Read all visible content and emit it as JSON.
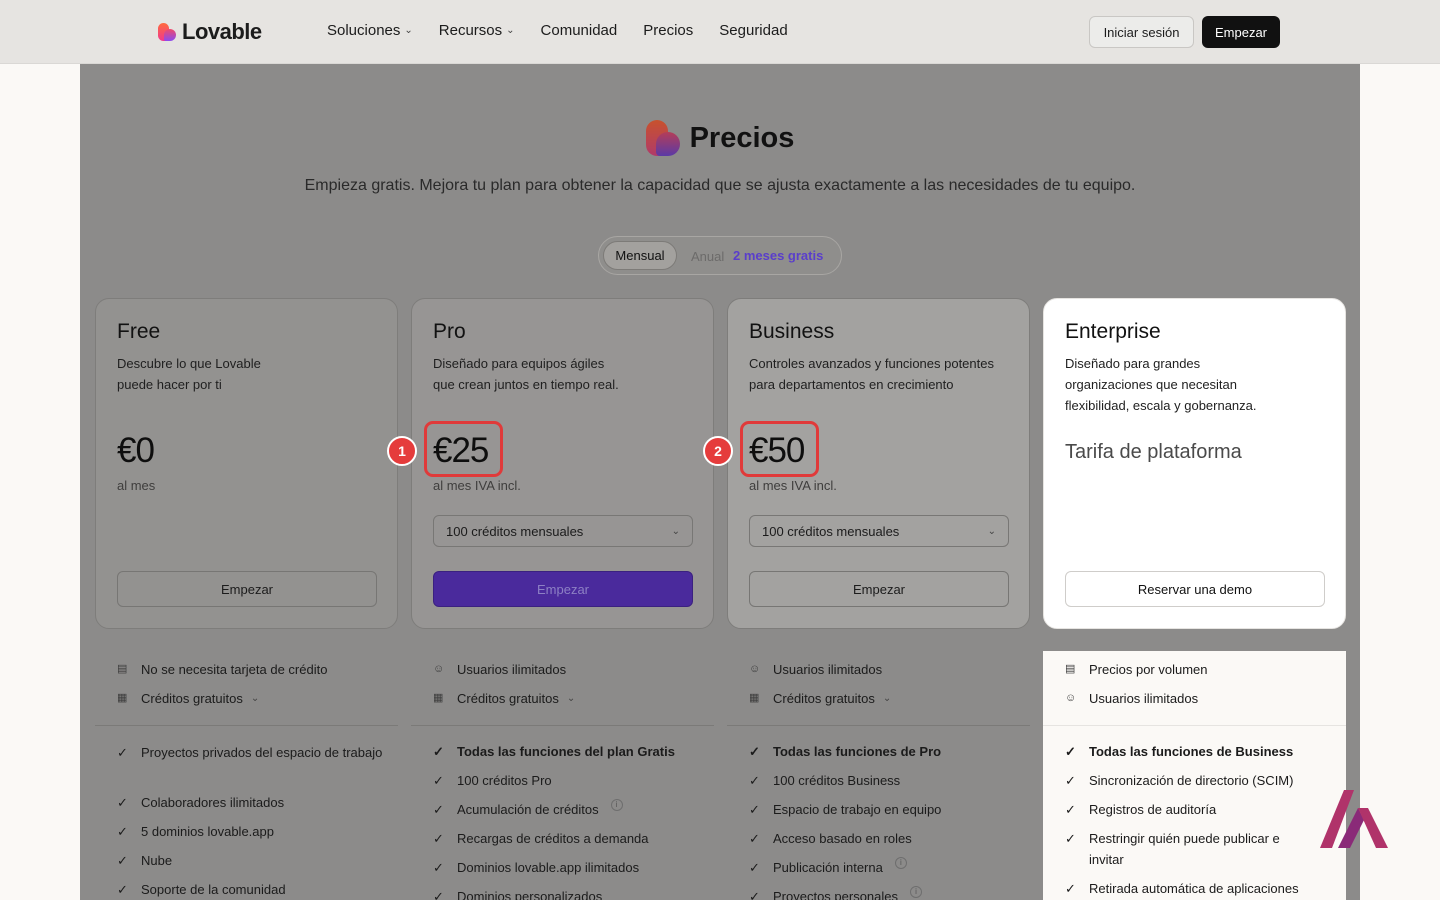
{
  "nav": {
    "brand": "Lovable",
    "links": [
      {
        "label": "Soluciones",
        "chevron": true
      },
      {
        "label": "Recursos",
        "chevron": true
      },
      {
        "label": "Comunidad",
        "chevron": false
      },
      {
        "label": "Precios",
        "chevron": false
      },
      {
        "label": "Seguridad",
        "chevron": false
      }
    ],
    "login": "Iniciar sesión",
    "start": "Empezar"
  },
  "hero": {
    "title": "Precios",
    "subtitle": "Empieza gratis. Mejora tu plan para obtener la capacidad que se ajusta exactamente a las necesidades de tu equipo.",
    "toggle_monthly": "Mensual",
    "toggle_annual": "Anual",
    "toggle_promo": "2 meses gratis"
  },
  "plans": [
    {
      "name": "Free",
      "desc": "Descubre lo que Lovable\npuede hacer por ti",
      "price": "€0",
      "price_note": "al mes",
      "button": "Empezar",
      "highlights": [
        {
          "icon": "card-icon",
          "text": "No se necesita tarjeta de crédito"
        },
        {
          "icon": "gift-icon",
          "text": "Créditos gratuitos",
          "chevron": true
        }
      ],
      "features": [
        "Proyectos privados del espacio de trabajo",
        "Colaboradores ilimitados",
        "5 dominios lovable.app",
        "Nube",
        "Soporte de la comunidad"
      ]
    },
    {
      "name": "Pro",
      "desc": "Diseñado para equipos ágiles\nque crean juntos en tiempo real.",
      "price": "€25",
      "price_note": "al mes IVA incl.",
      "select": "100 créditos mensuales",
      "button": "Empezar",
      "highlights": [
        {
          "icon": "users-icon",
          "text": "Usuarios ilimitados"
        },
        {
          "icon": "gift-icon",
          "text": "Créditos gratuitos",
          "chevron": true
        }
      ],
      "features": [
        "Todas las funciones del plan Gratis",
        "100 créditos Pro",
        "Acumulación de créditos",
        "Recargas de créditos a demanda",
        "Dominios lovable.app ilimitados",
        "Dominios personalizados"
      ]
    },
    {
      "name": "Business",
      "desc": "Controles avanzados y funciones potentes\npara departamentos en crecimiento",
      "price": "€50",
      "price_note": "al mes IVA incl.",
      "select": "100 créditos mensuales",
      "button": "Empezar",
      "highlights": [
        {
          "icon": "users-icon",
          "text": "Usuarios ilimitados"
        },
        {
          "icon": "gift-icon",
          "text": "Créditos gratuitos",
          "chevron": true
        }
      ],
      "features": [
        "Todas las funciones de Pro",
        "100 créditos Business",
        "Espacio de trabajo en equipo",
        "Acceso basado en roles",
        "Publicación interna",
        "Proyectos personales"
      ]
    },
    {
      "name": "Enterprise",
      "desc": "Diseñado para grandes\norganizaciones que necesitan\nflexibilidad, escala y gobernanza.",
      "platform": "Tarifa de plataforma",
      "button": "Reservar una demo",
      "highlights": [
        {
          "icon": "card-icon",
          "text": "Precios por volumen"
        },
        {
          "icon": "users-icon",
          "text": "Usuarios ilimitados"
        }
      ],
      "features": [
        "Todas las funciones de Business",
        "Sincronización de directorio (SCIM)",
        "Registros de auditoría",
        "Restringir quién puede publicar e invitar",
        "Retirada automática de aplicaciones"
      ]
    }
  ],
  "markers": [
    "1",
    "2"
  ]
}
